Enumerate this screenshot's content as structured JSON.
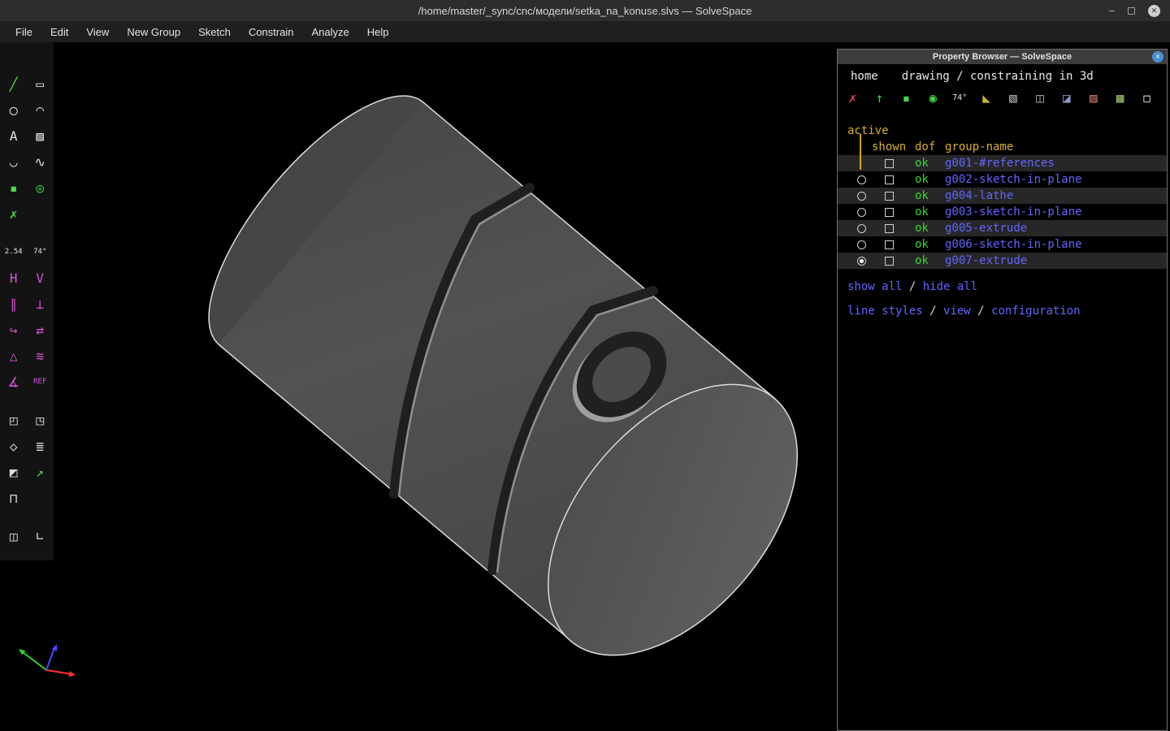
{
  "window": {
    "title": "/home/master/_sync/cnc/модели/setka_na_konuse.slvs — SolveSpace",
    "controls": {
      "minimize": "–",
      "close_glyph": "✕"
    }
  },
  "menubar": {
    "items": [
      "File",
      "Edit",
      "View",
      "New Group",
      "Sketch",
      "Constrain",
      "Analyze",
      "Help"
    ]
  },
  "colors": {
    "link": "#6464ff",
    "ok": "#30d930",
    "amber": "#d8b028",
    "line": "#d8a800"
  },
  "toolbar": {
    "rows": [
      {
        "items": [
          {
            "name": "line-segment-tool-icon",
            "glyph": "╱",
            "color": "#4ae04a"
          },
          {
            "name": "rectangle-tool-icon",
            "glyph": "▭",
            "color": "#e6e6e6"
          }
        ]
      },
      {
        "items": [
          {
            "name": "circle-tool-icon",
            "glyph": "◯",
            "color": "#e6e6e6"
          },
          {
            "name": "arc-tool-icon",
            "glyph": "◠",
            "color": "#e6e6e6"
          }
        ]
      },
      {
        "items": [
          {
            "name": "text-tool-icon",
            "glyph": "A",
            "color": "#e6e6e6"
          },
          {
            "name": "image-tool-icon",
            "glyph": "▨",
            "color": "#e6e6e6"
          }
        ]
      },
      {
        "items": [
          {
            "name": "tangent-arc-tool-icon",
            "glyph": "◡",
            "color": "#e6e6e6"
          },
          {
            "name": "bezier-tool-icon",
            "glyph": "∿",
            "color": "#e6e6e6"
          }
        ]
      },
      {
        "items": [
          {
            "name": "datum-point-tool-icon",
            "glyph": "▪",
            "color": "#4ae04a"
          },
          {
            "name": "construction-tool-icon",
            "glyph": "◎",
            "color": "#4ae04a"
          }
        ]
      },
      {
        "items": [
          {
            "name": "split-curves-tool-icon",
            "glyph": "✗",
            "color": "#4ae04a"
          },
          null
        ]
      },
      {
        "gap": true,
        "items": [
          {
            "name": "distance-constraint-icon",
            "glyph": "2.54",
            "color": "#e6e6e6",
            "small": true
          },
          {
            "name": "angle-constraint-icon",
            "glyph": "74°",
            "color": "#e6e6e6",
            "small": true
          }
        ]
      },
      {
        "items": [
          {
            "name": "horizontal-constraint-icon",
            "glyph": "H",
            "color": "#d855d8"
          },
          {
            "name": "vertical-constraint-icon",
            "glyph": "V",
            "color": "#d855d8"
          }
        ]
      },
      {
        "items": [
          {
            "name": "parallel-constraint-icon",
            "glyph": "∥",
            "color": "#d855d8"
          },
          {
            "name": "perpendicular-constraint-icon",
            "glyph": "⊥",
            "color": "#d855d8"
          }
        ]
      },
      {
        "items": [
          {
            "name": "tangent-constraint-icon",
            "glyph": "↪",
            "color": "#d855d8"
          },
          {
            "name": "coincident-constraint-icon",
            "glyph": "⇄",
            "color": "#d855d8"
          }
        ]
      },
      {
        "items": [
          {
            "name": "equal-constraint-icon",
            "glyph": "△",
            "color": "#d855d8"
          },
          {
            "name": "parallel-curves-constraint-icon",
            "glyph": "≋",
            "color": "#d855d8"
          }
        ]
      },
      {
        "items": [
          {
            "name": "other-angle-constraint-icon",
            "glyph": "∡",
            "color": "#d855d8"
          },
          {
            "name": "reference-dimension-icon",
            "glyph": "REF",
            "color": "#d855d8",
            "small": true
          }
        ]
      },
      {
        "gap": true,
        "items": [
          {
            "name": "extrude-group-icon",
            "glyph": "◰",
            "color": "#dcdcdc"
          },
          {
            "name": "lathe-group-icon",
            "glyph": "◳",
            "color": "#dcdcdc"
          }
        ]
      },
      {
        "items": [
          {
            "name": "translate-group-icon",
            "glyph": "◇",
            "color": "#dcdcdc"
          },
          {
            "name": "step-rotate-group-icon",
            "glyph": "≣",
            "color": "#dcdcdc"
          }
        ]
      },
      {
        "items": [
          {
            "name": "sketch-in-plane-icon",
            "glyph": "◩",
            "color": "#dcdcdc"
          },
          {
            "name": "sketch-in-3d-icon",
            "glyph": "↗",
            "color": "#4ae04a"
          }
        ]
      },
      {
        "items": [
          {
            "name": "bounding-box-icon",
            "glyph": "⊓",
            "color": "#dcdcdc"
          },
          null
        ]
      },
      {
        "gap": true,
        "items": [
          {
            "name": "link-file-icon",
            "glyph": "◫",
            "color": "#dcdcdc"
          },
          {
            "name": "corner-icon",
            "glyph": "∟",
            "color": "#dcdcdc"
          }
        ]
      }
    ]
  },
  "property_browser": {
    "title": "Property Browser — SolveSpace",
    "close_glyph": "✕",
    "nav": {
      "home": "home",
      "mode": "drawing / constraining in 3d"
    },
    "view_icons": [
      {
        "name": "toggle-workplanes-icon",
        "glyph": "✗",
        "color": "#e04545"
      },
      {
        "name": "toggle-normals-icon",
        "glyph": "↑",
        "color": "#46d446"
      },
      {
        "name": "toggle-points-icon",
        "glyph": "▪",
        "color": "#46d446"
      },
      {
        "name": "toggle-construction-icon",
        "glyph": "◉",
        "color": "#46d446"
      },
      {
        "name": "toggle-dimensions-icon",
        "glyph": "74°",
        "color": "#e8e8e8",
        "small": true
      },
      {
        "name": "toggle-outlines-icon",
        "glyph": "◣",
        "color": "#c8b830"
      },
      {
        "name": "toggle-shaded-icon",
        "glyph": "▧",
        "color": "#b0b0b0"
      },
      {
        "name": "toggle-edges-icon",
        "glyph": "◫",
        "color": "#b0b0b0"
      },
      {
        "name": "toggle-mesh-icon",
        "glyph": "◪",
        "color": "#8899cc"
      },
      {
        "name": "toggle-hidden-lines-icon",
        "glyph": "▨",
        "color": "#cc7766"
      },
      {
        "name": "toggle-faces-icon",
        "glyph": "▩",
        "color": "#99bb66"
      },
      {
        "name": "toggle-occluded-icon",
        "glyph": "◻",
        "color": "#e8e8e8",
        "right": true
      }
    ],
    "active_label": "active",
    "columns": {
      "shown": "shown",
      "dof": "dof",
      "group": "group-name"
    },
    "groups": [
      {
        "name": "g001-#references",
        "dof": "ok",
        "has_radio": false,
        "active": false,
        "checked": false
      },
      {
        "name": "g002-sketch-in-plane",
        "dof": "ok",
        "has_radio": true,
        "active": false,
        "checked": false
      },
      {
        "name": "g004-lathe",
        "dof": "ok",
        "has_radio": true,
        "active": false,
        "checked": false
      },
      {
        "name": "g003-sketch-in-plane",
        "dof": "ok",
        "has_radio": true,
        "active": false,
        "checked": false
      },
      {
        "name": "g005-extrude",
        "dof": "ok",
        "has_radio": true,
        "active": false,
        "checked": false
      },
      {
        "name": "g006-sketch-in-plane",
        "dof": "ok",
        "has_radio": true,
        "active": false,
        "checked": false
      },
      {
        "name": "g007-extrude",
        "dof": "ok",
        "has_radio": true,
        "active": true,
        "checked": false
      }
    ],
    "footer": {
      "separator": " / ",
      "row1": [
        {
          "label": "show all",
          "name": "show-all-link"
        },
        {
          "label": "hide all",
          "name": "hide-all-link"
        }
      ],
      "row2": [
        {
          "label": "line styles",
          "name": "line-styles-link"
        },
        {
          "label": "view",
          "name": "view-link"
        },
        {
          "label": "configuration",
          "name": "configuration-link"
        }
      ]
    }
  }
}
